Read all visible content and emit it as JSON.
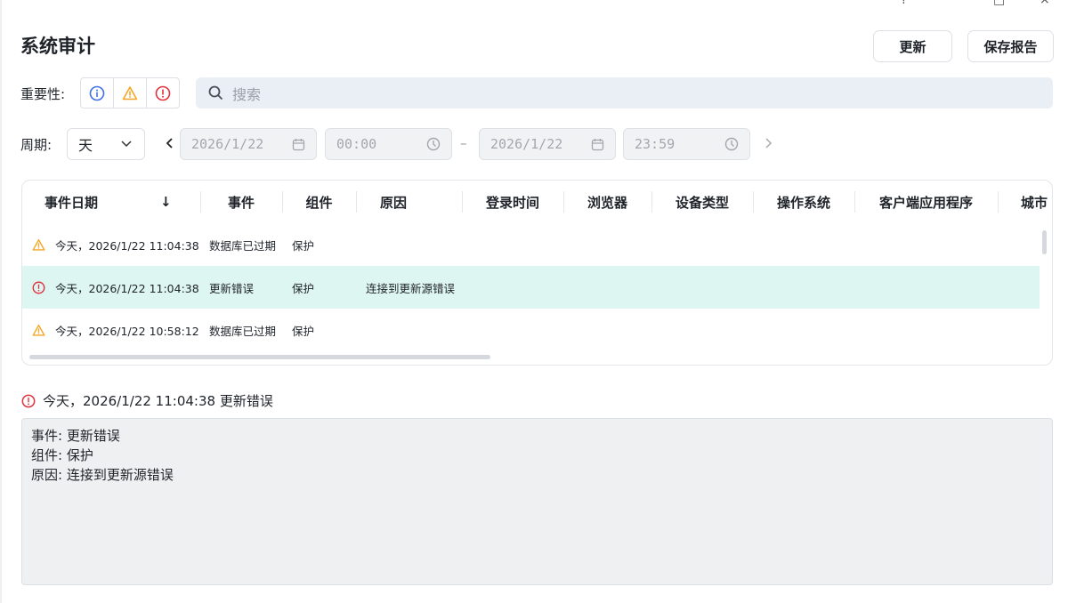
{
  "window": {
    "help": "?",
    "maximize": "□",
    "close": "×"
  },
  "title": "系统审计",
  "buttons": {
    "refresh": "更新",
    "save_report": "保存报告"
  },
  "filters": {
    "severity_label": "重要性:",
    "search_placeholder": "搜索",
    "period_label": "周期:",
    "period_value": "天",
    "start_date": "2026/1/22",
    "start_time": "00:00",
    "end_date": "2026/1/22",
    "end_time": "23:59",
    "dash": "–"
  },
  "table": {
    "columns": [
      "事件日期",
      "事件",
      "组件",
      "原因",
      "登录时间",
      "浏览器",
      "设备类型",
      "操作系统",
      "客户端应用程序",
      "城市"
    ],
    "sort_indicator": "↓",
    "rows": [
      {
        "severity": "warning",
        "date": "今天，2026/1/22 11:04:38",
        "event": "数据库已过期",
        "component": "保护",
        "reason": ""
      },
      {
        "severity": "error",
        "date": "今天，2026/1/22 11:04:38",
        "event": "更新错误",
        "component": "保护",
        "reason": "连接到更新源错误"
      },
      {
        "severity": "warning",
        "date": "今天，2026/1/22 10:58:12",
        "event": "数据库已过期",
        "component": "保护",
        "reason": ""
      }
    ]
  },
  "detail": {
    "header": "今天，2026/1/22 11:04:38 更新错误",
    "lines": [
      "事件: 更新错误",
      "组件: 保护",
      "原因: 连接到更新源错误"
    ]
  },
  "colors": {
    "info": "#3f6fe8",
    "warning": "#f5a623",
    "error": "#e0323e",
    "selected_row": "#def6f2"
  }
}
